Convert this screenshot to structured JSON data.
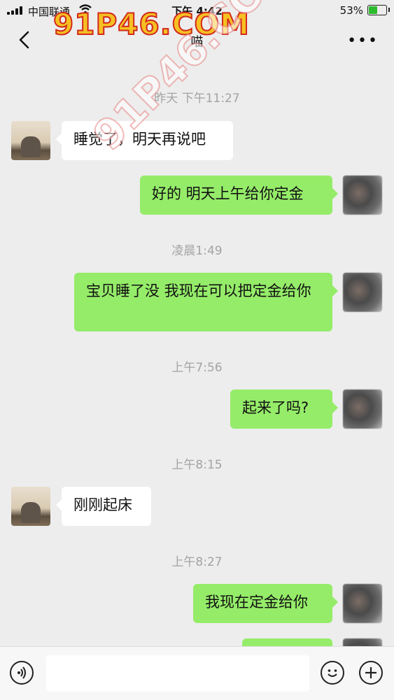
{
  "status_bar": {
    "carrier": "中国联通",
    "time": "下午 4:42",
    "battery": "53%"
  },
  "nav": {
    "title": "喵",
    "more": "•••"
  },
  "watermark": {
    "text": "91P46.COM"
  },
  "messages": [
    {
      "type": "timestamp",
      "text": "昨天 下午11:27"
    },
    {
      "type": "message",
      "from": "friend",
      "text": "睡觉了，明天再说吧"
    },
    {
      "type": "message",
      "from": "me",
      "text": "好的 明天上午给你定金"
    },
    {
      "type": "timestamp",
      "text": "凌晨1:49"
    },
    {
      "type": "message",
      "from": "me",
      "text": "宝贝睡了没 我现在可以把定金给你"
    },
    {
      "type": "timestamp",
      "text": "上午7:56"
    },
    {
      "type": "message",
      "from": "me",
      "text": "起来了吗?"
    },
    {
      "type": "timestamp",
      "text": "上午8:15"
    },
    {
      "type": "message",
      "from": "friend",
      "text": "刚刚起床"
    },
    {
      "type": "timestamp",
      "text": "上午8:27"
    },
    {
      "type": "message",
      "from": "me",
      "text": "我现在定金给你"
    },
    {
      "type": "message",
      "from": "me",
      "text": ""
    }
  ],
  "input_bar": {
    "value": "",
    "icons": [
      "voice-icon",
      "emoji-icon",
      "plus-icon"
    ]
  },
  "colors": {
    "background": "#ededed",
    "my_bubble": "#95ec69",
    "friend_bubble": "#ffffff",
    "timestamp": "#a3a3a3"
  }
}
